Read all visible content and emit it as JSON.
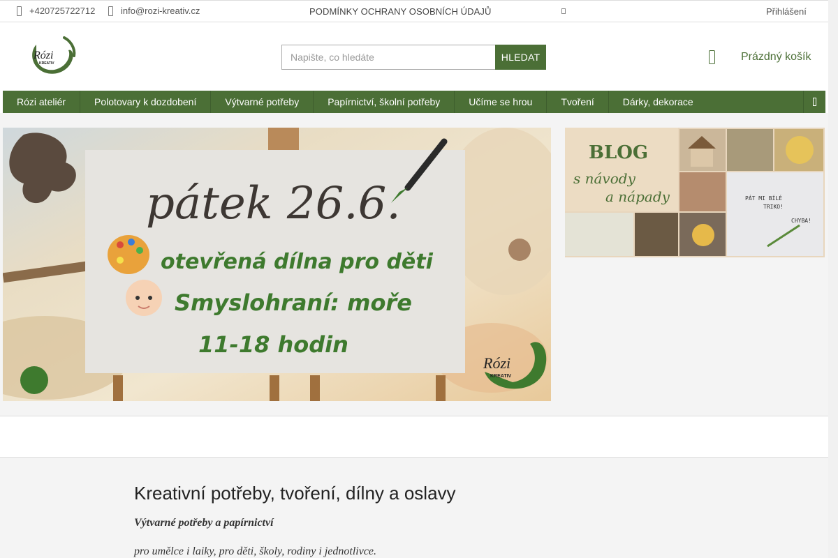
{
  "topbar": {
    "phone": "+420725722712",
    "email": "info@rozi-kreativ.cz",
    "privacy_link": "PODMÍNKY OCHRANY OSOBNÍCH ÚDAJŮ",
    "login": "Přihlášení"
  },
  "header": {
    "logo_text": "Rózi",
    "logo_subtext": "KREATIV",
    "search_placeholder": "Napište, co hledáte",
    "search_button": "HLEDAT",
    "cart_label": "Prázdný košík"
  },
  "nav": {
    "items": [
      {
        "label": "Rózi ateliér"
      },
      {
        "label": "Polotovary k dozdobení"
      },
      {
        "label": "Výtvarné potřeby"
      },
      {
        "label": "Papírnictví, školní potřeby"
      },
      {
        "label": "Učíme se hrou"
      },
      {
        "label": "Tvoření"
      },
      {
        "label": "Dárky, dekorace"
      }
    ]
  },
  "main_banner": {
    "line1": "pátek 26.6.",
    "line2": "otevřená dílna pro děti",
    "line3": "Smyslohraní: moře",
    "line4": "11-18 hodin",
    "logo_text": "Rózi",
    "logo_subtext": "KREATIV"
  },
  "blog_banner": {
    "title": "BLOG",
    "line1": "s návody",
    "line2": "a nápady",
    "shirt_text1": "PÁT MI BÍLÉ",
    "shirt_text2": "TRIKO!",
    "shirt_text3": "CHYBA!"
  },
  "content": {
    "heading": "Kreativní potřeby, tvoření, dílny a oslavy",
    "subheading": "Výtvarné potřeby a papírnictví",
    "line": "pro umělce i laiky, pro děti, školy, rodiny i jednotlivce."
  },
  "colors": {
    "brand_green": "#4b6f36",
    "banner_text_green": "#3e7a2e"
  }
}
